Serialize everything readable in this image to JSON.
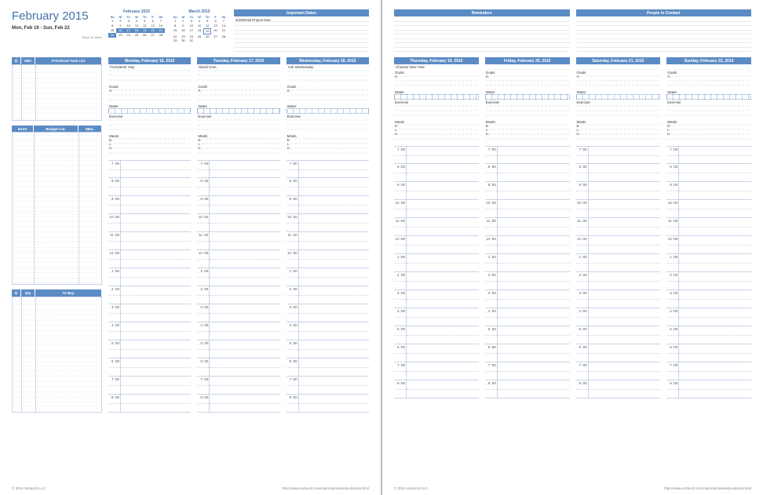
{
  "title": "February 2015",
  "date_range": "Mon, Feb 16  -  Sun, Feb 22",
  "wtw": "What-To-Wear",
  "mini_cals": [
    {
      "title": "February 2015",
      "dow": [
        "Su",
        "M",
        "Tu",
        "W",
        "Th",
        "F",
        "Sa"
      ],
      "cells": [
        "1",
        "2",
        "3",
        "4",
        "5",
        "6",
        "7",
        "8",
        "9",
        "10",
        "11",
        "12",
        "13",
        "14",
        "15",
        "16",
        "17",
        "18",
        "19",
        "20",
        "21",
        "22",
        "23",
        "24",
        "25",
        "26",
        "27",
        "28",
        "",
        ""
      ],
      "hl_start": 15,
      "hl_end": 21
    },
    {
      "title": "March 2015",
      "dow": [
        "Su",
        "M",
        "Tu",
        "W",
        "Th",
        "F",
        "Sa"
      ],
      "cells": [
        "1",
        "2",
        "3",
        "4",
        "5",
        "6",
        "7",
        "8",
        "9",
        "10",
        "11",
        "12",
        "13",
        "14",
        "15",
        "16",
        "17",
        "18",
        "19",
        "20",
        "21",
        "22",
        "23",
        "24",
        "25",
        "26",
        "27",
        "28",
        "29",
        "30",
        "31",
        "",
        "",
        "",
        ""
      ],
      "box_idx": 18
    }
  ],
  "important": {
    "header": "Important Dates",
    "items": [
      "3/19/2015    Project Due"
    ]
  },
  "reminders": {
    "header": "Reminders"
  },
  "contacts": {
    "header": "People to Contact"
  },
  "side": {
    "tasks": {
      "cols": [
        "☑",
        "ABC",
        "Prioritized Task List"
      ],
      "w": [
        12,
        18,
        85
      ]
    },
    "budget": {
      "cols": [
        "$Amt",
        "Budget Cat.",
        "$Bal."
      ],
      "w": [
        28,
        57,
        30
      ]
    },
    "buy": {
      "cols": [
        "☑",
        "Qty",
        "To Buy"
      ],
      "w": [
        12,
        18,
        85
      ]
    }
  },
  "section_labels": {
    "goals": "Goals",
    "a": "A.",
    "water": "Water",
    "exercise": "Exercise",
    "meals": "Meals",
    "b": "B:",
    "l": "L:",
    "d": "D:"
  },
  "days": [
    {
      "header": "Monday, February 16, 2015",
      "event": "Presidents' Day"
    },
    {
      "header": "Tuesday, February 17, 2015",
      "event": "Mardi Gras"
    },
    {
      "header": "Wednesday, February 18, 2015",
      "event": "Ash Wednesday"
    },
    {
      "header": "Thursday, February 19, 2015",
      "event": "Chinese New Year"
    },
    {
      "header": "Friday, February 20, 2015",
      "event": ""
    },
    {
      "header": "Saturday, February 21, 2015",
      "event": ""
    },
    {
      "header": "Sunday, February 22, 2015",
      "event": ""
    }
  ],
  "hours": [
    "7 :00",
    "8 :00",
    "9 :00",
    "10 :00",
    "11 :00",
    "12 :00",
    "1 :00",
    "2 :00",
    "3 :00",
    "4 :00",
    "5 :00",
    "6 :00",
    "7 :00",
    "8 :00"
  ],
  "footer": {
    "copyright": "© 2015 Vertex42 LLC",
    "url": "http://www.vertex42.com/calendars/weekly-planner.html"
  }
}
